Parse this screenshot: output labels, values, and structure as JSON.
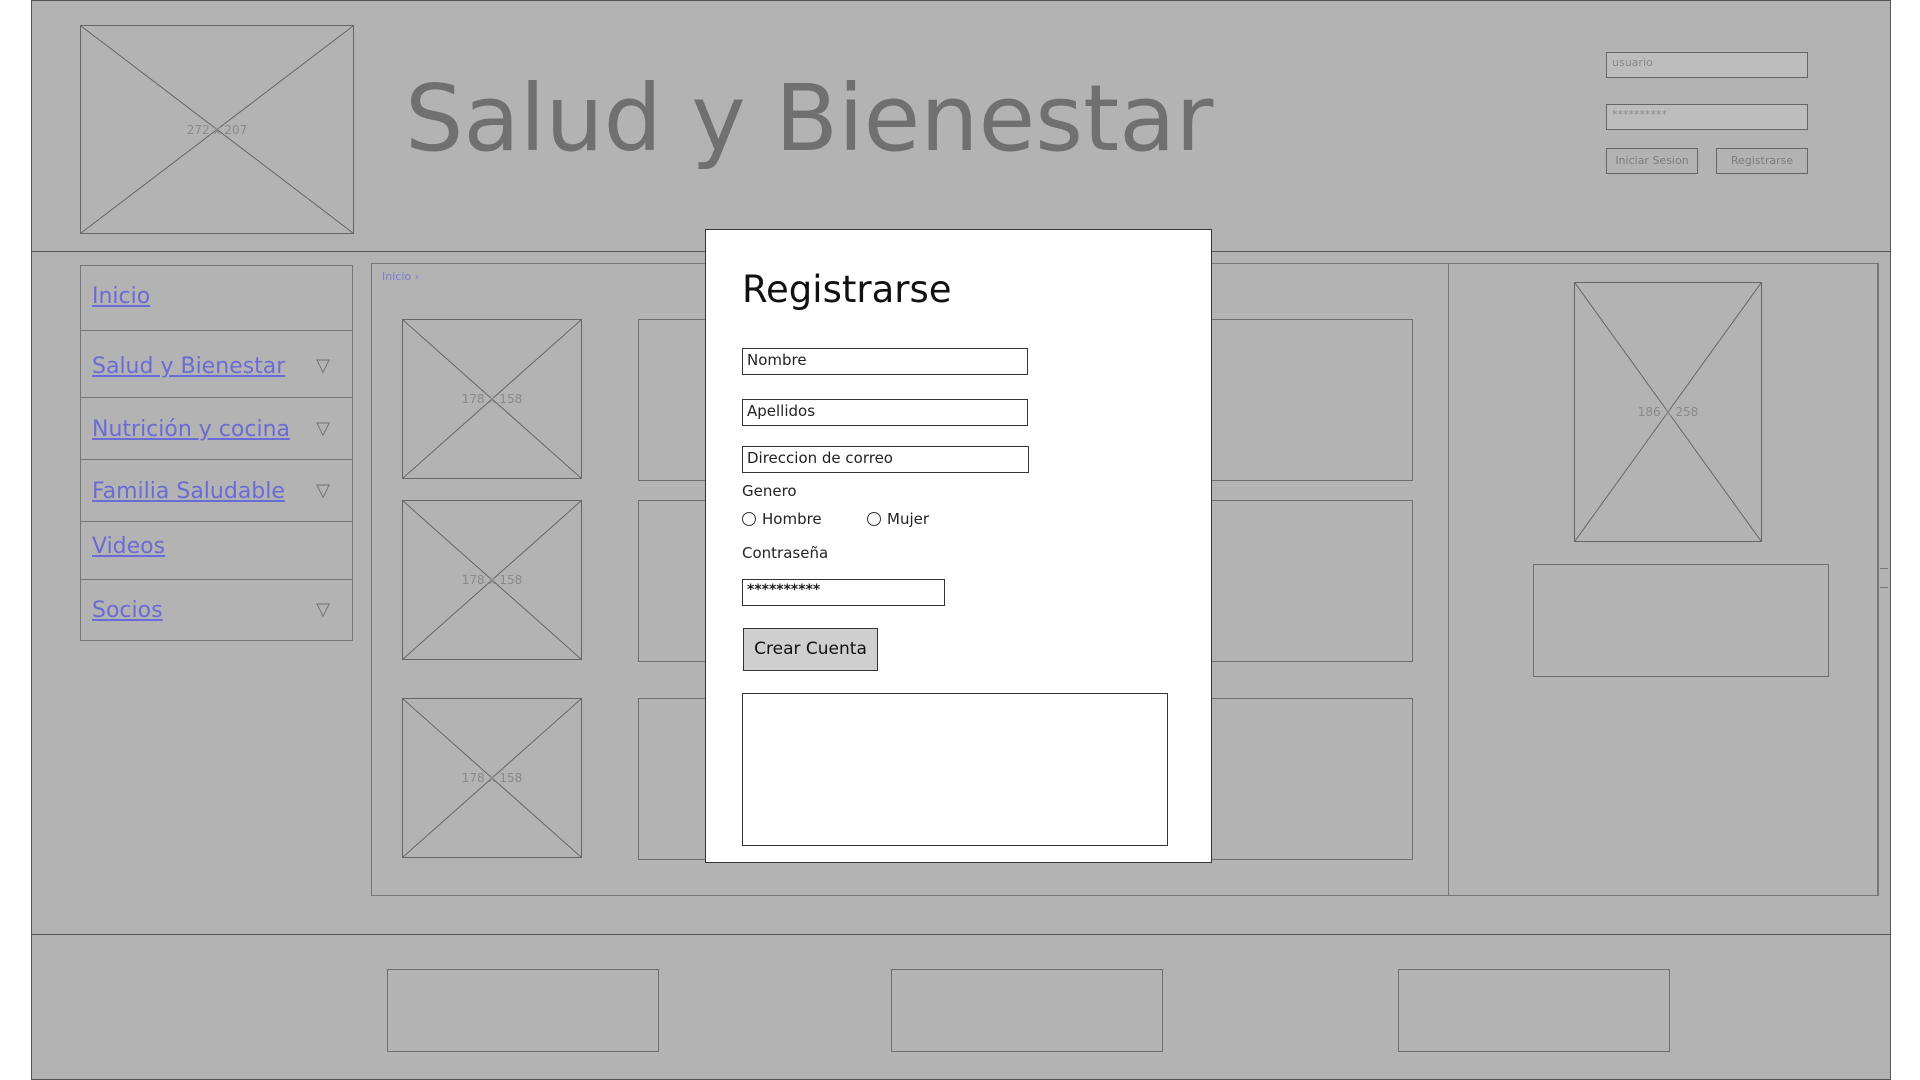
{
  "header": {
    "title": "Salud y Bienestar",
    "logo_placeholder": "272 x 207"
  },
  "login": {
    "username_placeholder": "usuario",
    "password_value": "**********",
    "login_button": "Iniciar Sesion",
    "register_button": "Registrarse"
  },
  "sidebar": {
    "items": [
      {
        "label": "Inicio"
      },
      {
        "label": "Salud y Bienestar",
        "chevron": "▽"
      },
      {
        "label": "Nutrición y cocina",
        "chevron": "▽"
      },
      {
        "label": "Familia Saludable",
        "chevron": "▽"
      },
      {
        "label": "Videos"
      },
      {
        "label": "Socios",
        "chevron": "▽"
      }
    ]
  },
  "breadcrumb": "Inicio ›",
  "content": {
    "thumb_placeholder": "178 x 158",
    "side_image_placeholder": "186 x 258"
  },
  "dialog": {
    "title": "Registrarse",
    "name_value": "Nombre",
    "surname_value": "Apellidos",
    "email_value": "Direccion de correo",
    "gender_label": "Genero",
    "gender_options": [
      "Hombre",
      "Mujer"
    ],
    "password_label": "Contraseña",
    "password_value": "**********",
    "submit_label": "Crear Cuenta"
  }
}
